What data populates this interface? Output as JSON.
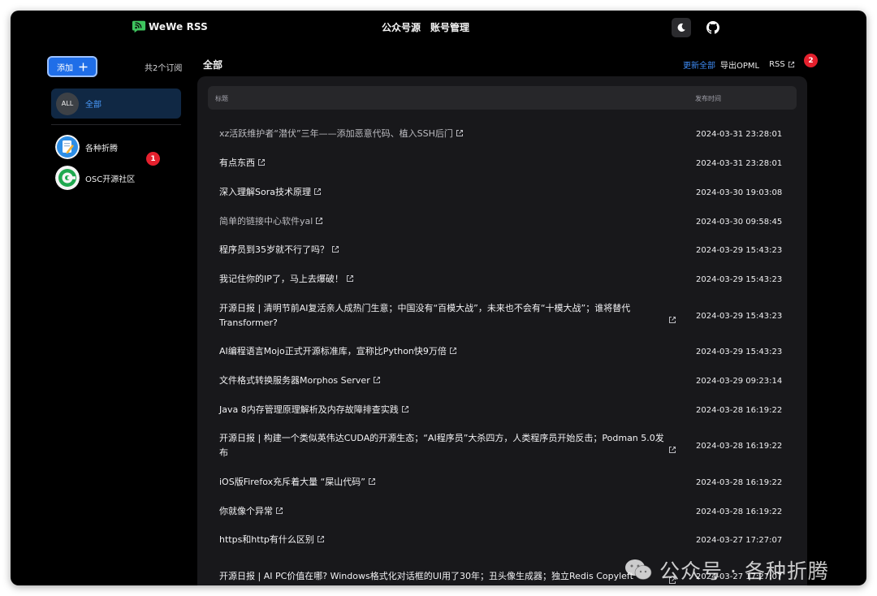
{
  "header": {
    "app_name": "WeWe RSS",
    "nav": [
      "公众号源",
      "账号管理"
    ]
  },
  "sidebar": {
    "add_label": "添加",
    "subscription_count": "共2个订阅",
    "all_avatar": "ALL",
    "all_label": "全部",
    "feeds": [
      {
        "name": "各种折腾",
        "icon": "pencil-note-avatar"
      },
      {
        "name": "OSC开源社区",
        "icon": "osc-logo-avatar"
      }
    ],
    "badge": "1"
  },
  "main": {
    "title": "全部",
    "actions": {
      "update_all": "更新全部",
      "export_opml": "导出OPML",
      "rss": "RSS"
    },
    "badge": "2",
    "table": {
      "col_title": "标题",
      "col_date": "发布时间",
      "rows": [
        {
          "title": "xz活跃维护者“潜伏”三年——添加恶意代码、植入SSH后门",
          "date": "2024-03-31 23:28:01",
          "dim": true
        },
        {
          "title": "有点东西",
          "date": "2024-03-31 23:28:01",
          "dim": false
        },
        {
          "title": "深入理解Sora技术原理",
          "date": "2024-03-30 19:03:08",
          "dim": false
        },
        {
          "title": "简单的链接中心软件yal",
          "date": "2024-03-30 09:58:45",
          "dim": true
        },
        {
          "title": "程序员到35岁就不行了吗？",
          "date": "2024-03-29 15:43:23",
          "dim": false
        },
        {
          "title": "我记住你的IP了，马上去爆破！",
          "date": "2024-03-29 15:43:23",
          "dim": false
        },
        {
          "title": "开源日报 | 清明节前AI复活亲人成热门生意；中国没有“百模大战”，未来也不会有“十模大战”；谁将替代Transformer?",
          "date": "2024-03-29 15:43:23",
          "dim": false
        },
        {
          "title": "AI编程语言Mojo正式开源标准库，宣称比Python快9万倍",
          "date": "2024-03-29 15:43:23",
          "dim": false
        },
        {
          "title": "文件格式转换服务器Morphos Server",
          "date": "2024-03-29 09:23:14",
          "dim": false
        },
        {
          "title": "Java 8内存管理原理解析及内存故障排查实践",
          "date": "2024-03-28 16:19:22",
          "dim": false
        },
        {
          "title": "开源日报 | 构建一个类似英伟达CUDA的开源生态；“AI程序员”大杀四方，人类程序员开始反击；Podman 5.0发布",
          "date": "2024-03-28 16:19:22",
          "dim": false
        },
        {
          "title": "iOS版Firefox充斥着大量 “屎山代码”",
          "date": "2024-03-28 16:19:22",
          "dim": false
        },
        {
          "title": "你就像个异常",
          "date": "2024-03-28 16:19:22",
          "dim": false
        },
        {
          "title": "https和http有什么区别",
          "date": "2024-03-27 17:27:07",
          "dim": false
        },
        {
          "title": "开源日报 | AI PC价值在哪? Windows格式化对话框的UI用了30年；丑头像生成器；独立Redis Copyleft",
          "date": "2024-03-27 17:27:07",
          "dim": false
        }
      ]
    }
  },
  "watermark": "公众号 · 各种折腾",
  "colors": {
    "accent": "#1f6ee8",
    "link": "#3f8df7",
    "badge": "#e5202d",
    "panel": "#18181b"
  }
}
